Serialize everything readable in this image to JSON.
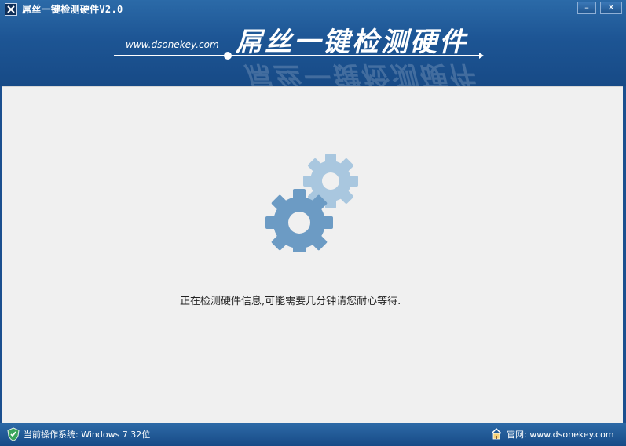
{
  "titlebar": {
    "title": "屌丝一键检测硬件V2.0",
    "minimize_label": "–",
    "close_label": "✕"
  },
  "banner": {
    "url": "www.dsonekey.com",
    "title": "屌丝一键检测硬件"
  },
  "main": {
    "message": "正在检测硬件信息,可能需要几分钟请您耐心等待."
  },
  "statusbar": {
    "os_info": "当前操作系统: Windows 7 32位",
    "website": "官网: www.dsonekey.com"
  },
  "colors": {
    "header_blue": "#1d5594",
    "gear_large": "#6c9bc4",
    "gear_small": "#a9c7df"
  },
  "icons": {
    "app": "app-icon",
    "shield": "shield-icon",
    "home": "home-icon",
    "gears": "gears-icon"
  }
}
